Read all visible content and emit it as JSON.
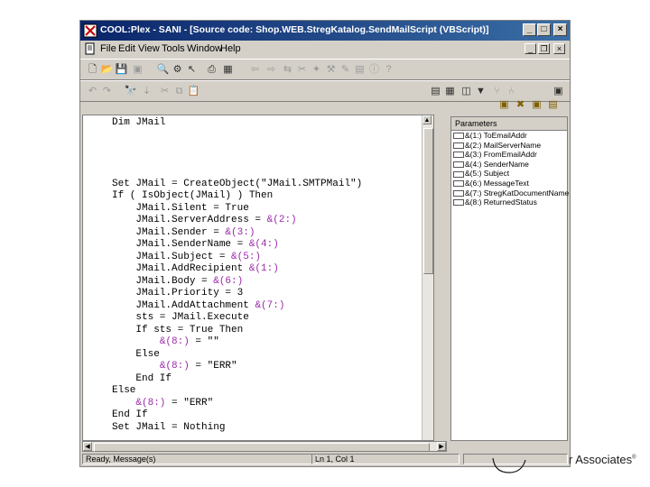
{
  "window": {
    "title": "COOL:Plex - SANI - [Source code: Shop.WEB.StregKatalog.SendMailScript (VBScript)]",
    "controls": {
      "minimize": "_",
      "maximize": "□",
      "close": "×"
    },
    "mdi_controls": {
      "minimize": "_",
      "restore": "❐",
      "close": "×"
    }
  },
  "menu": {
    "file": "File",
    "edit": "Edit",
    "view": "View",
    "tools": "Tools",
    "window": "Window",
    "help": "Help"
  },
  "toolbar1": {
    "icons": [
      "new-document-icon",
      "open-folder-icon",
      "save-icon",
      "save-all-icon",
      "find-icon",
      "model-icon",
      "pointer-icon",
      "print-icon",
      "print-preview-icon",
      "back-icon",
      "forward-icon",
      "link-icon",
      "scissors-icon",
      "magic-icon",
      "tools-icon",
      "properties-icon",
      "info-icon",
      "help-icon"
    ]
  },
  "toolbar2": {
    "icons": [
      "undo-icon",
      "redo-icon",
      "binoculars-icon",
      "cut-icon",
      "copy-icon",
      "paste-icon",
      "list-icon",
      "grid-icon",
      "table-icon",
      "filter-icon",
      "tree-icon",
      "tree2-icon",
      "panel-icon",
      "highlight1-icon",
      "highlight2-icon",
      "highlight3-icon",
      "highlight4-icon"
    ]
  },
  "code": {
    "lines": [
      [
        {
          "t": "Dim JMail",
          "c": "n"
        }
      ],
      [
        {
          "t": "",
          "c": "n"
        }
      ],
      [
        {
          "t": "",
          "c": "n"
        }
      ],
      [
        {
          "t": "",
          "c": "n"
        }
      ],
      [
        {
          "t": "",
          "c": "n"
        }
      ],
      [
        {
          "t": "Set JMail = CreateObject(\"JMail.SMTPMail\")",
          "c": "n"
        }
      ],
      [
        {
          "t": "If ( IsObject(JMail) ) Then",
          "c": "n"
        }
      ],
      [
        {
          "t": "    JMail.Silent = True",
          "c": "n"
        }
      ],
      [
        {
          "t": "    JMail.ServerAddress = ",
          "c": "n"
        },
        {
          "t": "&(2:)",
          "c": "p"
        }
      ],
      [
        {
          "t": "    JMail.Sender = ",
          "c": "n"
        },
        {
          "t": "&(3:)",
          "c": "p"
        }
      ],
      [
        {
          "t": "    JMail.SenderName = ",
          "c": "n"
        },
        {
          "t": "&(4:)",
          "c": "p"
        }
      ],
      [
        {
          "t": "    JMail.Subject = ",
          "c": "n"
        },
        {
          "t": "&(5:)",
          "c": "p"
        }
      ],
      [
        {
          "t": "    JMail.AddRecipient ",
          "c": "n"
        },
        {
          "t": "&(1:)",
          "c": "p"
        }
      ],
      [
        {
          "t": "    JMail.Body = ",
          "c": "n"
        },
        {
          "t": "&(6:)",
          "c": "p"
        }
      ],
      [
        {
          "t": "    JMail.Priority = 3",
          "c": "n"
        }
      ],
      [
        {
          "t": "    JMail.AddAttachment ",
          "c": "n"
        },
        {
          "t": "&(7:)",
          "c": "p"
        }
      ],
      [
        {
          "t": "    sts = JMail.Execute",
          "c": "n"
        }
      ],
      [
        {
          "t": "    If sts = True Then",
          "c": "n"
        }
      ],
      [
        {
          "t": "        ",
          "c": "n"
        },
        {
          "t": "&(8:)",
          "c": "p"
        },
        {
          "t": " = \"\"",
          "c": "n"
        }
      ],
      [
        {
          "t": "    Else",
          "c": "n"
        }
      ],
      [
        {
          "t": "        ",
          "c": "n"
        },
        {
          "t": "&(8:)",
          "c": "p"
        },
        {
          "t": " = \"ERR\"",
          "c": "n"
        }
      ],
      [
        {
          "t": "    End If",
          "c": "n"
        }
      ],
      [
        {
          "t": "Else",
          "c": "n"
        }
      ],
      [
        {
          "t": "    ",
          "c": "n"
        },
        {
          "t": "&(8:)",
          "c": "p"
        },
        {
          "t": " = \"ERR\"",
          "c": "n"
        }
      ],
      [
        {
          "t": "End If",
          "c": "n"
        }
      ],
      [
        {
          "t": "Set JMail = Nothing",
          "c": "n"
        }
      ]
    ]
  },
  "parameters": {
    "header": "Parameters",
    "items": [
      "&(1:) ToEmailAddr",
      "&(2:) MailServerName",
      "&(3:) FromEmailAddr",
      "&(4:) SenderName",
      "&(5:) Subject",
      "&(6:) MessageText",
      "&(7:) StregKatDocumentName",
      "&(8:) ReturnedStatus"
    ]
  },
  "status": {
    "left": "Ready, Message(s)",
    "position": "Ln 1, Col 1"
  },
  "branding": {
    "text": "r Associates",
    "mark": "®"
  }
}
